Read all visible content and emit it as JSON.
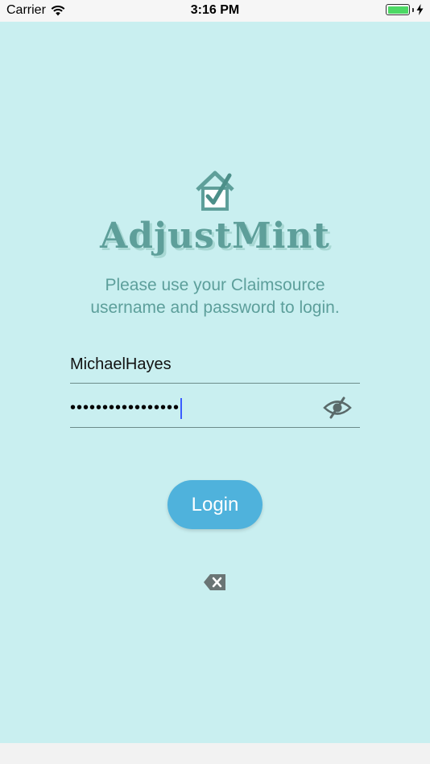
{
  "status_bar": {
    "carrier": "Carrier",
    "time": "3:16 PM",
    "icons": [
      "wifi-icon",
      "battery-icon",
      "charging-bolt-icon"
    ]
  },
  "logo": {
    "icon": "house-check-icon",
    "brand_name": "AdjustMint"
  },
  "instructions": {
    "line1": "Please use your Claimsource",
    "line2": "username and password to login."
  },
  "form": {
    "username_value": "MichaelHayes",
    "password_masked": "•••••••••••••••••",
    "password_toggle_icon": "eye-slash-icon"
  },
  "login_button": {
    "label": "Login"
  },
  "clear_icon": "clear-delete-icon",
  "colors": {
    "background": "#c9eff0",
    "accent_teal": "#5e9f9a",
    "button": "#4fb2dc",
    "caret": "#3a5cff",
    "battery": "#4cd964"
  }
}
